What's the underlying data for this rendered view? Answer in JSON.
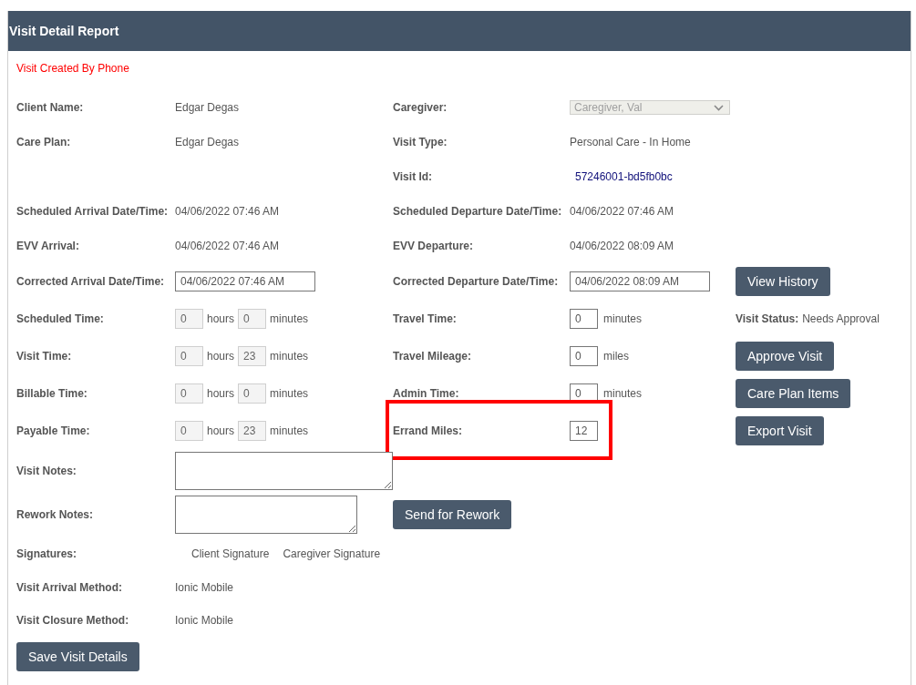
{
  "header": {
    "title": "Visit Detail Report"
  },
  "notice": "Visit Created By Phone",
  "rows": [
    {
      "left": {
        "label": "Client Name:",
        "kind": "text",
        "value": "Edgar Degas"
      },
      "right": {
        "label": "Caregiver:",
        "kind": "select",
        "value": "Caregiver, Val",
        "disabled": true
      }
    },
    {
      "left": {
        "label": "Care Plan:",
        "kind": "text",
        "value": "Edgar Degas"
      },
      "right": {
        "label": "Visit Type:",
        "kind": "text",
        "value": "Personal Care - In Home"
      }
    },
    {
      "right": {
        "label": "Visit Id:",
        "kind": "id",
        "value": "57246001-bd5fb0bc"
      }
    },
    {
      "left": {
        "label": "Scheduled Arrival Date/Time:",
        "kind": "text",
        "value": "04/06/2022 07:46 AM"
      },
      "right": {
        "label": "Scheduled Departure Date/Time:",
        "kind": "text",
        "value": "04/06/2022 07:46 AM"
      }
    },
    {
      "left": {
        "label": "EVV Arrival:",
        "kind": "text",
        "value": "04/06/2022 07:46 AM"
      },
      "right": {
        "label": "EVV Departure:",
        "kind": "text",
        "value": "04/06/2022 08:09 AM"
      }
    },
    {
      "left": {
        "label": "Corrected Arrival Date/Time:",
        "kind": "date",
        "value": "04/06/2022 07:46 AM"
      },
      "right": {
        "label": "Corrected Departure Date/Time:",
        "kind": "date",
        "value": "04/06/2022 08:09 AM"
      },
      "action": {
        "kind": "button",
        "label": "View History"
      }
    },
    {
      "left": {
        "label": "Scheduled Time:",
        "kind": "duration",
        "hours": {
          "value": "0",
          "disabled": true
        },
        "hours_unit": "hours",
        "minutes": {
          "value": "0",
          "disabled": true
        },
        "minutes_unit": "minutes"
      },
      "right": {
        "label": "Travel Time:",
        "kind": "number",
        "value": "0",
        "disabled": false,
        "unit": "minutes"
      },
      "action": {
        "kind": "status",
        "label": "Visit Status:",
        "value": "Needs Approval"
      }
    },
    {
      "left": {
        "label": "Visit Time:",
        "kind": "duration",
        "hours": {
          "value": "0",
          "disabled": true
        },
        "hours_unit": "hours",
        "minutes": {
          "value": "23",
          "disabled": true
        },
        "minutes_unit": "minutes"
      },
      "right": {
        "label": "Travel Mileage:",
        "kind": "number",
        "value": "0",
        "disabled": false,
        "unit": "miles"
      },
      "action": {
        "kind": "button",
        "label": "Approve Visit"
      }
    },
    {
      "left": {
        "label": "Billable Time:",
        "kind": "duration",
        "hours": {
          "value": "0",
          "disabled": true
        },
        "hours_unit": "hours",
        "minutes": {
          "value": "0",
          "disabled": true
        },
        "minutes_unit": "minutes"
      },
      "right": {
        "label": "Admin Time:",
        "kind": "number",
        "value": "0",
        "disabled": false,
        "unit": "minutes"
      },
      "action": {
        "kind": "button",
        "label": "Care Plan Items"
      }
    },
    {
      "left": {
        "label": "Payable Time:",
        "kind": "duration",
        "hours": {
          "value": "0",
          "disabled": true
        },
        "hours_unit": "hours",
        "minutes": {
          "value": "23",
          "disabled": true
        },
        "minutes_unit": "minutes"
      },
      "right": {
        "label": "Errand Miles:",
        "kind": "number",
        "value": "12",
        "disabled": false,
        "highlighted": true
      },
      "action": {
        "kind": "button",
        "label": "Export Visit"
      }
    },
    {
      "left": {
        "label": "Visit Notes:",
        "kind": "textarea"
      }
    },
    {
      "left": {
        "label": "Rework Notes:",
        "kind": "short_textarea"
      },
      "right": {
        "kind": "button",
        "value": "Send for Rework"
      }
    },
    {
      "left": {
        "label": "Signatures:",
        "kind": "signatures",
        "values": [
          "Client Signature",
          "Caregiver Signature"
        ]
      }
    },
    {
      "left": {
        "label": "Visit Arrival Method:",
        "kind": "text",
        "value": "Ionic Mobile"
      }
    },
    {
      "left": {
        "label": "Visit Closure Method:",
        "kind": "text",
        "value": "Ionic Mobile"
      }
    }
  ],
  "save_button": "Save Visit Details"
}
